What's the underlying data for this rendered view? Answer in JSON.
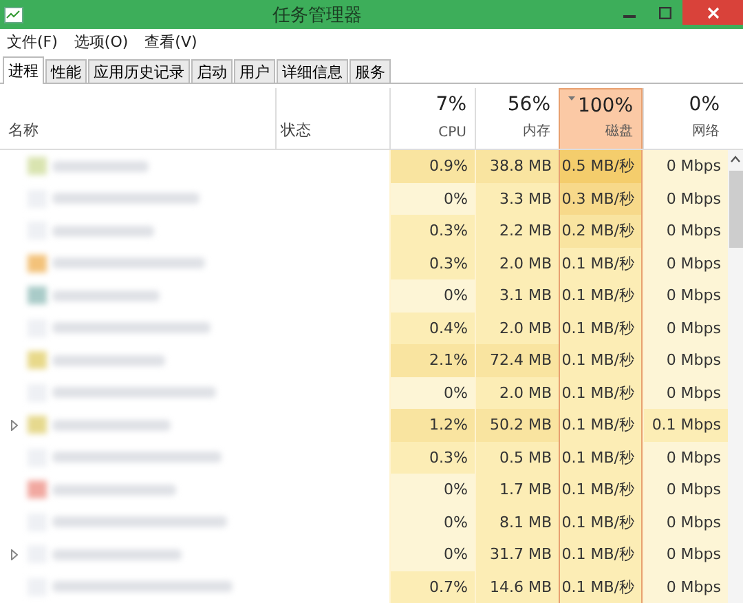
{
  "window": {
    "title": "任务管理器"
  },
  "menu": [
    "文件(F)",
    "选项(O)",
    "查看(V)"
  ],
  "tabs": [
    {
      "label": "进程",
      "selected": true
    },
    {
      "label": "性能",
      "selected": false
    },
    {
      "label": "应用历史记录",
      "selected": false
    },
    {
      "label": "启动",
      "selected": false
    },
    {
      "label": "用户",
      "selected": false
    },
    {
      "label": "详细信息",
      "selected": false
    },
    {
      "label": "服务",
      "selected": false
    }
  ],
  "columns": [
    {
      "kind": "text",
      "label": "名称"
    },
    {
      "kind": "text",
      "label": "状态"
    },
    {
      "kind": "metric",
      "percent": "7%",
      "label": "CPU",
      "sorted": false
    },
    {
      "kind": "metric",
      "percent": "56%",
      "label": "内存",
      "sorted": false
    },
    {
      "kind": "metric",
      "percent": "100%",
      "label": "磁盘",
      "sorted": true
    },
    {
      "kind": "metric",
      "percent": "0%",
      "label": "网络",
      "sorted": false
    }
  ],
  "rows": [
    {
      "expandable": false,
      "color": "#d9e4b0",
      "cells": [
        {
          "text": "0.9%",
          "color": "#f9e4a0"
        },
        {
          "text": "38.8 MB",
          "color": "#f9e4a0"
        },
        {
          "text": "0.5 MB/秒",
          "color": "#f4cd6c"
        },
        {
          "text": "0 Mbps",
          "color": "#fdf5d6"
        }
      ]
    },
    {
      "expandable": false,
      "cells": [
        {
          "text": "0%",
          "color": "#fdf5d6"
        },
        {
          "text": "3.3 MB",
          "color": "#fcedb5"
        },
        {
          "text": "0.3 MB/秒",
          "color": "#f7d98a"
        },
        {
          "text": "0 Mbps",
          "color": "#fdf5d6"
        }
      ]
    },
    {
      "expandable": false,
      "cells": [
        {
          "text": "0.3%",
          "color": "#fcedb5"
        },
        {
          "text": "2.2 MB",
          "color": "#fcedb5"
        },
        {
          "text": "0.2 MB/秒",
          "color": "#f9e4a0"
        },
        {
          "text": "0 Mbps",
          "color": "#fdf5d6"
        }
      ]
    },
    {
      "expandable": false,
      "color": "#f3c27a",
      "cells": [
        {
          "text": "0.3%",
          "color": "#fcedb5"
        },
        {
          "text": "2.0 MB",
          "color": "#fcedb5"
        },
        {
          "text": "0.1 MB/秒",
          "color": "#fcedb5"
        },
        {
          "text": "0 Mbps",
          "color": "#fdf5d6"
        }
      ]
    },
    {
      "expandable": false,
      "color": "#a9cbc8",
      "cells": [
        {
          "text": "0%",
          "color": "#fdf5d6"
        },
        {
          "text": "3.1 MB",
          "color": "#fcedb5"
        },
        {
          "text": "0.1 MB/秒",
          "color": "#fcedb5"
        },
        {
          "text": "0 Mbps",
          "color": "#fdf5d6"
        }
      ]
    },
    {
      "expandable": false,
      "cells": [
        {
          "text": "0.4%",
          "color": "#fcedb5"
        },
        {
          "text": "2.0 MB",
          "color": "#fcedb5"
        },
        {
          "text": "0.1 MB/秒",
          "color": "#fcedb5"
        },
        {
          "text": "0 Mbps",
          "color": "#fdf5d6"
        }
      ]
    },
    {
      "expandable": false,
      "color": "#e8d98a",
      "cells": [
        {
          "text": "2.1%",
          "color": "#f9e4a0"
        },
        {
          "text": "72.4 MB",
          "color": "#f9e4a0"
        },
        {
          "text": "0.1 MB/秒",
          "color": "#fcedb5"
        },
        {
          "text": "0 Mbps",
          "color": "#fdf5d6"
        }
      ]
    },
    {
      "expandable": false,
      "cells": [
        {
          "text": "0%",
          "color": "#fdf5d6"
        },
        {
          "text": "2.0 MB",
          "color": "#fcedb5"
        },
        {
          "text": "0.1 MB/秒",
          "color": "#fcedb5"
        },
        {
          "text": "0 Mbps",
          "color": "#fdf5d6"
        }
      ]
    },
    {
      "expandable": true,
      "color": "#e6d98e",
      "cells": [
        {
          "text": "1.2%",
          "color": "#f9e4a0"
        },
        {
          "text": "50.2 MB",
          "color": "#f9e4a0"
        },
        {
          "text": "0.1 MB/秒",
          "color": "#fcedb5"
        },
        {
          "text": "0.1 Mbps",
          "color": "#fcedb5"
        }
      ]
    },
    {
      "expandable": false,
      "cells": [
        {
          "text": "0.3%",
          "color": "#fcedb5"
        },
        {
          "text": "0.5 MB",
          "color": "#fcedb5"
        },
        {
          "text": "0.1 MB/秒",
          "color": "#fcedb5"
        },
        {
          "text": "0 Mbps",
          "color": "#fdf5d6"
        }
      ]
    },
    {
      "expandable": false,
      "color": "#f1a8a0",
      "cells": [
        {
          "text": "0%",
          "color": "#fdf5d6"
        },
        {
          "text": "1.7 MB",
          "color": "#fcedb5"
        },
        {
          "text": "0.1 MB/秒",
          "color": "#fcedb5"
        },
        {
          "text": "0 Mbps",
          "color": "#fdf5d6"
        }
      ]
    },
    {
      "expandable": false,
      "cells": [
        {
          "text": "0%",
          "color": "#fdf5d6"
        },
        {
          "text": "8.1 MB",
          "color": "#fcedb5"
        },
        {
          "text": "0.1 MB/秒",
          "color": "#fcedb5"
        },
        {
          "text": "0 Mbps",
          "color": "#fdf5d6"
        }
      ]
    },
    {
      "expandable": true,
      "cells": [
        {
          "text": "0%",
          "color": "#fdf5d6"
        },
        {
          "text": "31.7 MB",
          "color": "#fcedb5"
        },
        {
          "text": "0.1 MB/秒",
          "color": "#fcedb5"
        },
        {
          "text": "0 Mbps",
          "color": "#fdf5d6"
        }
      ]
    },
    {
      "expandable": false,
      "cells": [
        {
          "text": "0.7%",
          "color": "#fcedb5"
        },
        {
          "text": "14.6 MB",
          "color": "#fcedb5"
        },
        {
          "text": "0.1 MB/秒",
          "color": "#fcedb5"
        },
        {
          "text": "0 Mbps",
          "color": "#fdf5d6"
        }
      ]
    }
  ]
}
